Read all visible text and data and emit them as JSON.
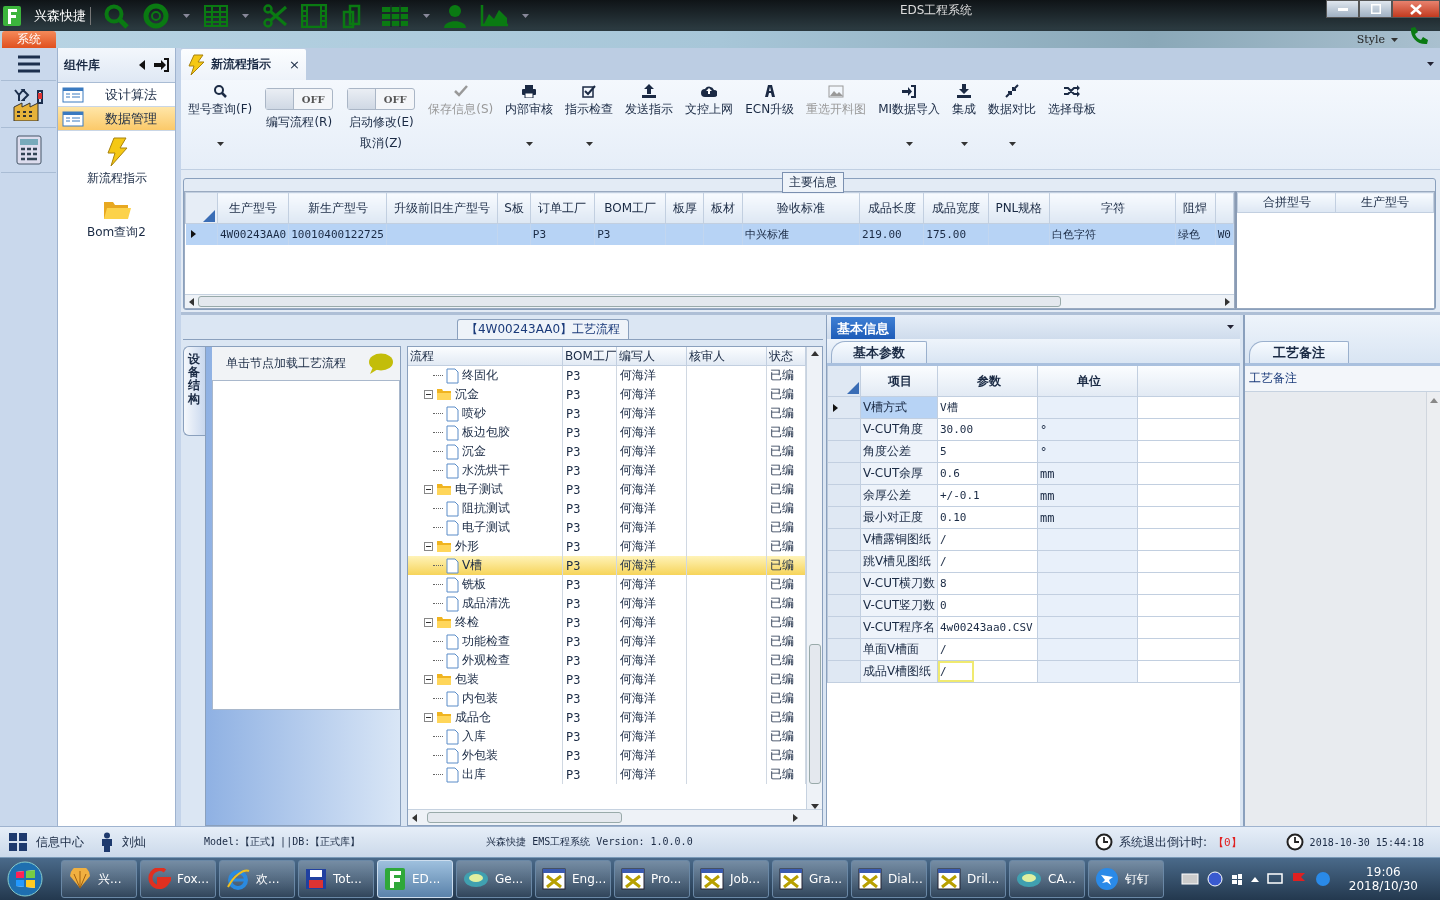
{
  "window": {
    "app_name": "兴森快捷",
    "title": "EDS工程系统",
    "style_menu": "Style",
    "ribbon_tab": "系统"
  },
  "sidebar": {
    "title": "组件库",
    "items": [
      {
        "label": "设计算法",
        "selected": false
      },
      {
        "label": "数据管理",
        "selected": true
      }
    ],
    "tools": [
      {
        "label": "新流程指示"
      },
      {
        "label": "Bom查询2"
      }
    ]
  },
  "document_tab": {
    "label": "新流程指示",
    "close": "×"
  },
  "toolbar": [
    {
      "kind": "button",
      "label": "型号查询(F)",
      "menu": true,
      "disabled": false
    },
    {
      "kind": "toggle",
      "label": "编写流程(R)",
      "state_text": "OFF",
      "on": false
    },
    {
      "kind": "toggle",
      "label": "启动修改(E)",
      "label_2": "取消(Z)",
      "state_text": "OFF",
      "on": false
    },
    {
      "kind": "button",
      "label": "保存信息(S)",
      "menu": false,
      "disabled": true
    },
    {
      "kind": "button",
      "label": "内部审核",
      "menu": true,
      "disabled": false
    },
    {
      "kind": "button",
      "label": "指示检查",
      "menu": true,
      "disabled": false
    },
    {
      "kind": "button",
      "label": "发送指示",
      "menu": false,
      "disabled": false
    },
    {
      "kind": "button",
      "label": "文控上网",
      "menu": false,
      "disabled": false
    },
    {
      "kind": "button",
      "label": "ECN升级",
      "menu": false,
      "disabled": false
    },
    {
      "kind": "button",
      "label": "重选开料图",
      "menu": false,
      "disabled": true
    },
    {
      "kind": "button",
      "label": "MI数据导入",
      "menu": true,
      "disabled": false
    },
    {
      "kind": "button",
      "label": "集成",
      "menu": true,
      "disabled": false
    },
    {
      "kind": "button",
      "label": "数据对比",
      "menu": true,
      "disabled": false
    },
    {
      "kind": "button",
      "label": "选择母板",
      "menu": false,
      "disabled": false
    }
  ],
  "main_info": {
    "title": "主要信息",
    "columns": [
      "生产型号",
      "新生产型号",
      "升级前旧生产型号",
      "S板",
      "订单工厂",
      "BOM工厂",
      "板厚",
      "板材",
      "验收标准",
      "成品长度",
      "成品宽度",
      "PNL规格",
      "字符",
      "阻焊",
      null
    ],
    "rows": [
      {
        "selected": true,
        "cells": [
          "4W00243AA0",
          "10010400122725",
          null,
          null,
          "P3",
          "P3",
          null,
          null,
          "中兴标准",
          "219.00",
          "175.00",
          null,
          "白色字符",
          "绿色",
          "W0"
        ]
      }
    ],
    "side_columns": [
      "合拼型号",
      "生产型号"
    ]
  },
  "process": {
    "title": "【4W00243AA0】工艺流程",
    "device_tab": "设备结构",
    "device_hint": "单击节点加载工艺流程",
    "columns": [
      "流程",
      "BOM工厂",
      "编写人",
      "核审人",
      "状态"
    ],
    "tree": [
      {
        "expanded": true,
        "children": [
          {
            "label": "终固化",
            "bom": "P3",
            "author": "何海洋",
            "status": "已编",
            "selected": false
          }
        ]
      },
      {
        "label": "沉金",
        "bom": "P3",
        "author": "何海洋",
        "status": "已编",
        "selected": false,
        "expanded": true,
        "children": [
          {
            "label": "喷砂",
            "bom": "P3",
            "author": "何海洋",
            "status": "已编",
            "selected": false
          },
          {
            "label": "板边包胶",
            "bom": "P3",
            "author": "何海洋",
            "status": "已编",
            "selected": false
          },
          {
            "label": "沉金",
            "bom": "P3",
            "author": "何海洋",
            "status": "已编",
            "selected": false
          },
          {
            "label": "水洗烘干",
            "bom": "P3",
            "author": "何海洋",
            "status": "已编",
            "selected": false
          }
        ]
      },
      {
        "label": "电子测试",
        "bom": "P3",
        "author": "何海洋",
        "status": "已编",
        "selected": false,
        "expanded": true,
        "children": [
          {
            "label": "阻抗测试",
            "bom": "P3",
            "author": "何海洋",
            "status": "已编",
            "selected": false
          },
          {
            "label": "电子测试",
            "bom": "P3",
            "author": "何海洋",
            "status": "已编",
            "selected": false
          }
        ]
      },
      {
        "label": "外形",
        "bom": "P3",
        "author": "何海洋",
        "status": "已编",
        "selected": false,
        "expanded": true,
        "children": [
          {
            "label": "V槽",
            "bom": "P3",
            "author": "何海洋",
            "status": "已编",
            "selected": true
          },
          {
            "label": "铣板",
            "bom": "P3",
            "author": "何海洋",
            "status": "已编",
            "selected": false
          },
          {
            "label": "成品清洗",
            "bom": "P3",
            "author": "何海洋",
            "status": "已编",
            "selected": false
          }
        ]
      },
      {
        "label": "终检",
        "bom": "P3",
        "author": "何海洋",
        "status": "已编",
        "selected": false,
        "expanded": true,
        "children": [
          {
            "label": "功能检查",
            "bom": "P3",
            "author": "何海洋",
            "status": "已编",
            "selected": false
          },
          {
            "label": "外观检查",
            "bom": "P3",
            "author": "何海洋",
            "status": "已编",
            "selected": false
          }
        ]
      },
      {
        "label": "包装",
        "bom": "P3",
        "author": "何海洋",
        "status": "已编",
        "selected": false,
        "expanded": true,
        "children": [
          {
            "label": "内包装",
            "bom": "P3",
            "author": "何海洋",
            "status": "已编",
            "selected": false
          }
        ]
      },
      {
        "label": "成品仓",
        "bom": "P3",
        "author": "何海洋",
        "status": "已编",
        "selected": false,
        "expanded": true,
        "children": [
          {
            "label": "入库",
            "bom": "P3",
            "author": "何海洋",
            "status": "已编",
            "selected": false
          },
          {
            "label": "外包装",
            "bom": "P3",
            "author": "何海洋",
            "status": "已编",
            "selected": false
          },
          {
            "label": "出库",
            "bom": "P3",
            "author": "何海洋",
            "status": "已编",
            "selected": false
          }
        ]
      }
    ]
  },
  "basic_info": {
    "tab": "基本信息",
    "subtab": "基本参数",
    "columns": [
      "项目",
      "参数",
      "单位"
    ],
    "rows": [
      {
        "item": "V槽方式",
        "value": "V槽",
        "selected": true,
        "editing": false
      },
      {
        "item": "V-CUT角度",
        "value": "30.00",
        "unit": "°",
        "selected": false,
        "editing": false
      },
      {
        "item": "角度公差",
        "value": "5",
        "unit": "°",
        "selected": false,
        "editing": false
      },
      {
        "item": "V-CUT余厚",
        "value": "0.6",
        "unit": "mm",
        "selected": false,
        "editing": false
      },
      {
        "item": "余厚公差",
        "value": "+/-0.1",
        "unit": "mm",
        "selected": false,
        "editing": false
      },
      {
        "item": "最小对正度",
        "value": "0.10",
        "unit": "mm",
        "selected": false,
        "editing": false
      },
      {
        "item": "V槽露铜图纸",
        "value": "/",
        "selected": false,
        "editing": false
      },
      {
        "item": "跳V槽见图纸",
        "value": "/",
        "selected": false,
        "editing": false
      },
      {
        "item": "V-CUT横刀数",
        "value": "8",
        "selected": false,
        "editing": false
      },
      {
        "item": "V-CUT竖刀数",
        "value": "0",
        "selected": false,
        "editing": false
      },
      {
        "item": "V-CUT程序名",
        "value": "4w00243aa0.CSV",
        "selected": false,
        "editing": false
      },
      {
        "item": "单面V槽面",
        "value": "/",
        "selected": false,
        "editing": false
      },
      {
        "item": "成品V槽图纸",
        "value": "/",
        "selected": false,
        "editing": true
      }
    ]
  },
  "notes": {
    "tab": "工艺备注",
    "heading": "工艺备注"
  },
  "status_bar": {
    "info_center": "信息中心",
    "user": "刘灿",
    "model": "Model:【正式】||DB:【正式库】",
    "product": "兴森快捷 EMS工程系统 Version: 1.0.0.0",
    "countdown_label": "系统退出倒计时:",
    "countdown": "【0】",
    "datetime": "2018-10-30 15:44:18"
  },
  "taskbar": {
    "items": [
      {
        "label": "兴...",
        "selected": false
      },
      {
        "label": "Fox...",
        "selected": false
      },
      {
        "label": "欢...",
        "selected": false
      },
      {
        "label": "Tot...",
        "selected": false
      },
      {
        "label": "ED...",
        "selected": true
      },
      {
        "label": "Ge...",
        "selected": false
      },
      {
        "label": "Eng...",
        "selected": false
      },
      {
        "label": "Pro...",
        "selected": false
      },
      {
        "label": "Job...",
        "selected": false
      },
      {
        "label": "Gra...",
        "selected": false
      },
      {
        "label": "Dial...",
        "selected": false
      },
      {
        "label": "Dril...",
        "selected": false
      },
      {
        "label": "CA...",
        "selected": false
      },
      {
        "label": "钉钉",
        "selected": false
      }
    ],
    "time": "19:06",
    "date": "2018/10/30"
  }
}
